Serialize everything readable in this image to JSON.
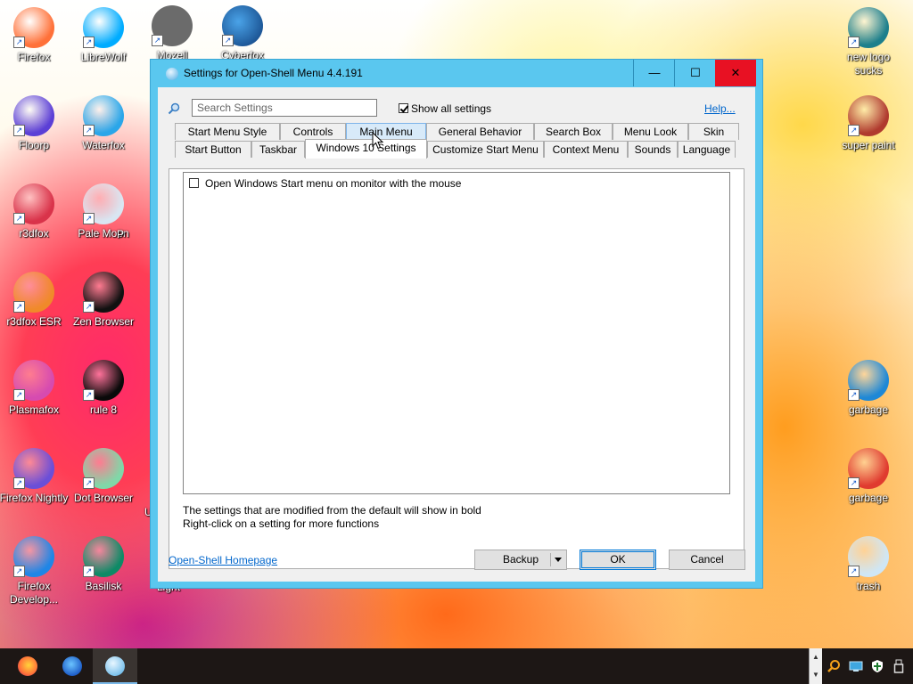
{
  "desktop": {
    "icons_left": [
      {
        "label": "Firefox",
        "icon": "firefox-icon",
        "color": "#ff7139"
      },
      {
        "label": "LibreWolf",
        "icon": "librewolf-icon",
        "color": "#00acff"
      },
      {
        "label": "Floorp",
        "icon": "floorp-icon",
        "color": "#5b3fd6"
      },
      {
        "label": "Waterfox",
        "icon": "waterfox-icon",
        "color": "#2aa6e9"
      },
      {
        "label": "r3dfox",
        "icon": "r3dfox-icon",
        "color": "#d9334a"
      },
      {
        "label": "Pale Moon",
        "icon": "pale-moon-icon",
        "color": "#d9e6f2"
      },
      {
        "label": "r3dfox ESR",
        "icon": "r3dfox-esr-icon",
        "color": "#f08a2a"
      },
      {
        "label": "Zen Browser",
        "icon": "zen-browser-icon",
        "color": "#111111"
      },
      {
        "label": "Plasmafox",
        "icon": "plasmafox-icon",
        "color": "#d64bb0"
      },
      {
        "label": "rule 8",
        "icon": "rule-8-icon",
        "color": "#0a0a0a"
      },
      {
        "label": "Firefox Nightly",
        "icon": "firefox-nightly-icon",
        "color": "#6b4fd8"
      },
      {
        "label": "Dot Browser",
        "icon": "dot-browser-icon",
        "color": "#7fd8a8"
      },
      {
        "label": "Firefox Develop...",
        "icon": "firefox-developer-icon",
        "color": "#1f86e6"
      },
      {
        "label": "Basilisk",
        "icon": "basilisk-icon",
        "color": "#0e8a66"
      }
    ],
    "icons_top_partial": [
      "Mozell",
      "Cyberfox"
    ],
    "icons_right": [
      {
        "label": "new logo sucks",
        "icon": "new-logo-icon",
        "color": "#1d7f8c"
      },
      {
        "label": "super paint",
        "icon": "super-paint-icon",
        "color": "#b03a2e"
      },
      {
        "label": "garbage",
        "icon": "edge-icon",
        "color": "#1e88d6"
      },
      {
        "label": "garbage",
        "icon": "chrome-icon",
        "color": "#e03b2f"
      },
      {
        "label": "trash",
        "icon": "recycle-bin-icon",
        "color": "#cfe6f5"
      }
    ],
    "partial_labels": {
      "pale_moon_neighbor": "P",
      "dot_browser_neighbor": "U",
      "basilisk_neighbor": "Light"
    }
  },
  "dialog": {
    "title": "Settings for Open-Shell Menu 4.4.191",
    "controls": {
      "minimize": "—",
      "maximize": "☐",
      "close": "✕"
    },
    "search": {
      "placeholder": "Search Settings"
    },
    "show_all": {
      "label": "Show all settings",
      "checked": true
    },
    "help": "Help...",
    "tabs_row1": [
      "Start Menu Style",
      "Controls",
      "Main Menu",
      "General Behavior",
      "Search Box",
      "Menu Look",
      "Skin"
    ],
    "tabs_row2": [
      "Start Button",
      "Taskbar",
      "Windows 10 Settings",
      "Customize Start Menu",
      "Context Menu",
      "Sounds",
      "Language"
    ],
    "active_tab": "Windows 10 Settings",
    "hover_tab": "Main Menu",
    "option": {
      "label": "Open Windows Start menu on monitor with the mouse",
      "checked": false
    },
    "info_line1": "The settings that are modified from the default will show in bold",
    "info_line2": "Right-click on a setting for more functions",
    "homepage": "Open-Shell Homepage",
    "buttons": {
      "backup": "Backup",
      "ok": "OK",
      "cancel": "Cancel"
    }
  },
  "taskbar": {
    "apps": [
      {
        "name": "firefox",
        "icon": "firefox-icon",
        "color": "#ff7139"
      },
      {
        "name": "waterfox",
        "icon": "waterfox-icon",
        "color": "#1f86e6"
      },
      {
        "name": "pale moon",
        "icon": "pale-moon-icon",
        "color": "#7ab8e8",
        "active": true
      }
    ],
    "tray_icons": [
      "search-icon",
      "network-icon",
      "shield-icon",
      "usb-icon"
    ]
  }
}
